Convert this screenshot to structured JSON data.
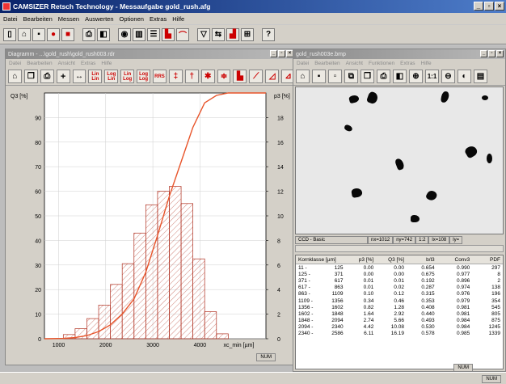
{
  "app": {
    "title": "CAMSIZER Retsch Technology - Messaufgabe gold_rush.afg",
    "menu": [
      "Datei",
      "Bearbeiten",
      "Messen",
      "Auswerten",
      "Optionen",
      "Extras",
      "Hilfe"
    ],
    "status_num": "NUM"
  },
  "toolbar_icons": [
    "new-icon",
    "open-icon",
    "save-icon",
    "record-icon",
    "stop-icon",
    "print-icon",
    "preview-icon",
    "camera-icon",
    "bars-icon",
    "list-icon",
    "histogram-icon",
    "curve-icon",
    "filter-icon",
    "compare-icon",
    "chart-icon",
    "grid-icon",
    "help-icon"
  ],
  "diagram_window": {
    "title": "Diagramm - ...\\gold_rush\\gold_rush003.rdr",
    "menu": [
      "Datei",
      "Bearbeiten",
      "Ansicht",
      "Extras",
      "Hilfe"
    ],
    "buttons": [
      "Lin Lin",
      "Log Lin",
      "Lin Log",
      "Log Log",
      "RRS"
    ],
    "status_num": "NUM"
  },
  "image_window": {
    "title": "gold_rush003e.bmp",
    "menu": [
      "Datei",
      "Bearbeiten",
      "Ansicht",
      "Funktionen",
      "Extras",
      "Hilfe"
    ],
    "status": {
      "camera": "CCD - Basic",
      "nx": "nx=1012",
      "ny": "ny=742",
      "scale": "1:2",
      "lx": "lx=108",
      "ly": "ly="
    },
    "status_num": "NUM"
  },
  "table": {
    "headers": [
      "Kornklasse [µm]",
      "p3 [%]",
      "Q3 [%]",
      "b/l3",
      "Conv3",
      "PDF"
    ],
    "rows": [
      [
        "11 -",
        "125",
        "0.00",
        "0.00",
        "0.654",
        "0.990",
        "297"
      ],
      [
        "125 -",
        "371",
        "0.00",
        "0.00",
        "0.675",
        "0.977",
        "8"
      ],
      [
        "371 -",
        "617",
        "0.01",
        "0.01",
        "0.192",
        "0.896",
        "2"
      ],
      [
        "617 -",
        "863",
        "0.01",
        "0.02",
        "0.287",
        "0.974",
        "138"
      ],
      [
        "863 -",
        "1109",
        "0.10",
        "0.12",
        "0.315",
        "0.976",
        "196"
      ],
      [
        "1109 -",
        "1356",
        "0.34",
        "0.46",
        "0.353",
        "0.979",
        "354"
      ],
      [
        "1356 -",
        "1602",
        "0.82",
        "1.28",
        "0.408",
        "0.981",
        "545"
      ],
      [
        "1602 -",
        "1848",
        "1.64",
        "2.92",
        "0.440",
        "0.981",
        "805"
      ],
      [
        "1848 -",
        "2094",
        "2.74",
        "5.66",
        "0.493",
        "0.984",
        "875"
      ],
      [
        "2094 -",
        "2340",
        "4.42",
        "10.08",
        "0.530",
        "0.984",
        "1245"
      ],
      [
        "2340 -",
        "2586",
        "6.11",
        "16.19",
        "0.578",
        "0.985",
        "1339"
      ]
    ]
  },
  "colors": {
    "curve": "#e8542a",
    "bar_stroke": "#b03020",
    "bar_fill": "#fbe7e2"
  },
  "chart_data": {
    "type": "bar",
    "xlabel": "xc_min [µm]",
    "ylabel_left": "Q3 [%]",
    "ylabel_right": "p3 [%]",
    "xlim": [
      700,
      5400
    ],
    "xticks": [
      1000,
      2000,
      3000,
      4000
    ],
    "ylim_left": [
      0,
      100
    ],
    "yticks_left": [
      0,
      10,
      20,
      30,
      40,
      50,
      60,
      70,
      80,
      90
    ],
    "ylim_right": [
      0,
      20
    ],
    "yticks_right": [
      0,
      2,
      4,
      6,
      8,
      10,
      12,
      14,
      16,
      18
    ],
    "bars_p3": {
      "bin_edges": [
        1100,
        1350,
        1600,
        1850,
        2100,
        2350,
        2600,
        2850,
        3100,
        3350,
        3600,
        3850,
        4100,
        4350
      ],
      "values": [
        0.34,
        0.82,
        1.64,
        2.74,
        4.42,
        6.11,
        8.6,
        10.9,
        12.0,
        12.4,
        11.0,
        6.5,
        2.2,
        0.4
      ]
    },
    "curve_q3": {
      "x": [
        700,
        1100,
        1350,
        1600,
        1850,
        2100,
        2350,
        2600,
        2850,
        3100,
        3350,
        3600,
        3850,
        4100,
        4350,
        4600,
        5400
      ],
      "y": [
        0,
        0.12,
        0.46,
        1.28,
        2.92,
        5.66,
        10.08,
        16.19,
        27,
        42,
        58,
        72,
        86,
        96,
        99,
        100,
        100
      ]
    },
    "grid": true
  }
}
